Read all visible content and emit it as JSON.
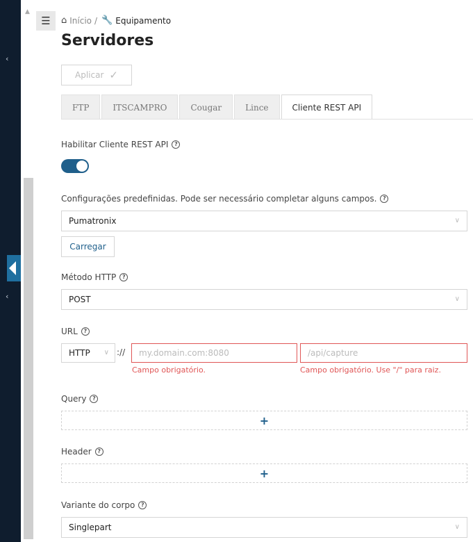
{
  "breadcrumb": {
    "home": "Início",
    "separator": "/",
    "current": "Equipamento"
  },
  "page_title": "Servidores",
  "apply_button": "Aplicar",
  "tabs": [
    {
      "label": "FTP",
      "active": false
    },
    {
      "label": "ITSCAMPRO",
      "active": false
    },
    {
      "label": "Cougar",
      "active": false
    },
    {
      "label": "Lince",
      "active": false
    },
    {
      "label": "Cliente REST API",
      "active": true
    }
  ],
  "enable_client": {
    "label": "Habilitar Cliente REST API",
    "enabled": true
  },
  "presets": {
    "label": "Configurações predefinidas. Pode ser necessário completar alguns campos.",
    "selected": "Pumatronix",
    "load_button": "Carregar"
  },
  "http_method": {
    "label": "Método HTTP",
    "selected": "POST"
  },
  "url": {
    "label": "URL",
    "protocol": "HTTP",
    "separator": "://",
    "host_placeholder": "my.domain.com:8080",
    "host_error": "Campo obrigatório.",
    "path_placeholder": "/api/capture",
    "path_error": "Campo obrigatório. Use \"/\" para raiz."
  },
  "query": {
    "label": "Query",
    "add": "+"
  },
  "header": {
    "label": "Header",
    "add": "+"
  },
  "body_variant": {
    "label": "Variante do corpo",
    "selected": "Singlepart"
  },
  "colors": {
    "accent": "#1f5f8b",
    "error": "#e05555",
    "nav": "#0f1d2e"
  },
  "icons": [
    "menu-icon",
    "home-icon",
    "wrench-icon",
    "check-icon",
    "help-icon",
    "chevron-down-icon",
    "collapse-arrow-icon"
  ]
}
